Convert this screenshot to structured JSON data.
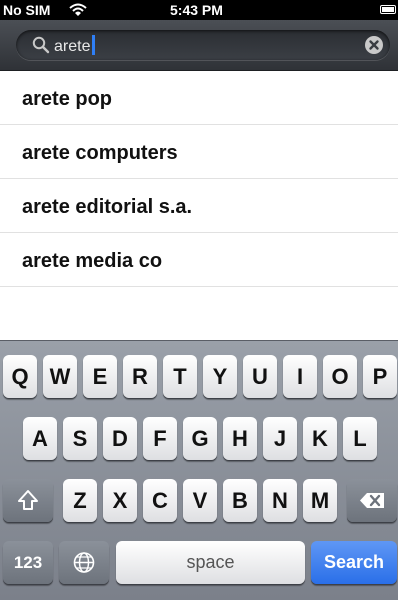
{
  "status_bar": {
    "carrier": "No SIM",
    "time": "5:43 PM"
  },
  "search": {
    "value": "arete",
    "icons": {
      "left": "magnifier-icon",
      "clear": "clear-icon"
    }
  },
  "suggestions": [
    "arete pop",
    "arete computers",
    "arete editorial s.a.",
    "arete media co"
  ],
  "keyboard": {
    "row1": [
      "Q",
      "W",
      "E",
      "R",
      "T",
      "Y",
      "U",
      "I",
      "O",
      "P"
    ],
    "row2": [
      "A",
      "S",
      "D",
      "F",
      "G",
      "H",
      "J",
      "K",
      "L"
    ],
    "row3": [
      "Z",
      "X",
      "C",
      "V",
      "B",
      "N",
      "M"
    ],
    "num_label": "123",
    "space_label": "space",
    "action_label": "Search",
    "icons": {
      "shift": "shift-icon",
      "delete": "delete-icon",
      "globe": "globe-icon"
    },
    "colors": {
      "search_key": "#2a6fe8"
    }
  }
}
